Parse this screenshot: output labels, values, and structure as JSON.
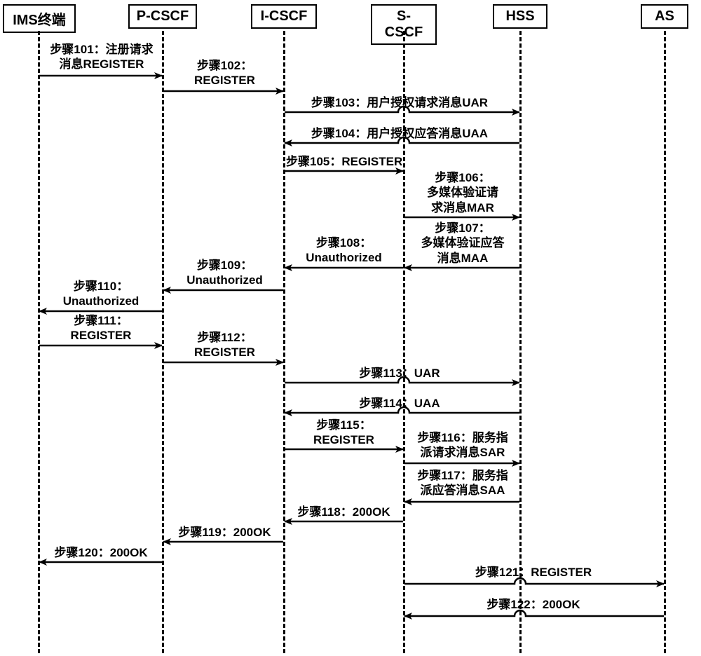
{
  "actors": {
    "ims": "IMS终端",
    "pcscf": "P-CSCF",
    "icscf": "I-CSCF",
    "scscf": "S-CSCF",
    "hss": "HSS",
    "as": "AS"
  },
  "messages": {
    "m101": "步骤101：注册请求\n消息REGISTER",
    "m102": "步骤102：\nREGISTER",
    "m103": "步骤103：用户授权请求消息UAR",
    "m104": "步骤104：用户授权应答消息UAA",
    "m105": "步骤105：REGISTER",
    "m106": "步骤106：\n多媒体验证请\n求消息MAR",
    "m107": "步骤107：\n多媒体验证应答\n消息MAA",
    "m108": "步骤108：\nUnauthorized",
    "m109": "步骤109：\nUnauthorized",
    "m110": "步骤110：\nUnauthorized",
    "m111": "步骤111：\nREGISTER",
    "m112": "步骤112：\nREGISTER",
    "m113": "步骤113：UAR",
    "m114": "步骤114：UAA",
    "m115": "步骤115：\nREGISTER",
    "m116": "步骤116：服务指\n派请求消息SAR",
    "m117": "步骤117：服务指\n派应答消息SAA",
    "m118": "步骤118：200OK",
    "m119": "步骤119：200OK",
    "m120": "步骤120：200OK",
    "m121": "步骤121：REGISTER",
    "m122": "步骤122：200OK"
  }
}
